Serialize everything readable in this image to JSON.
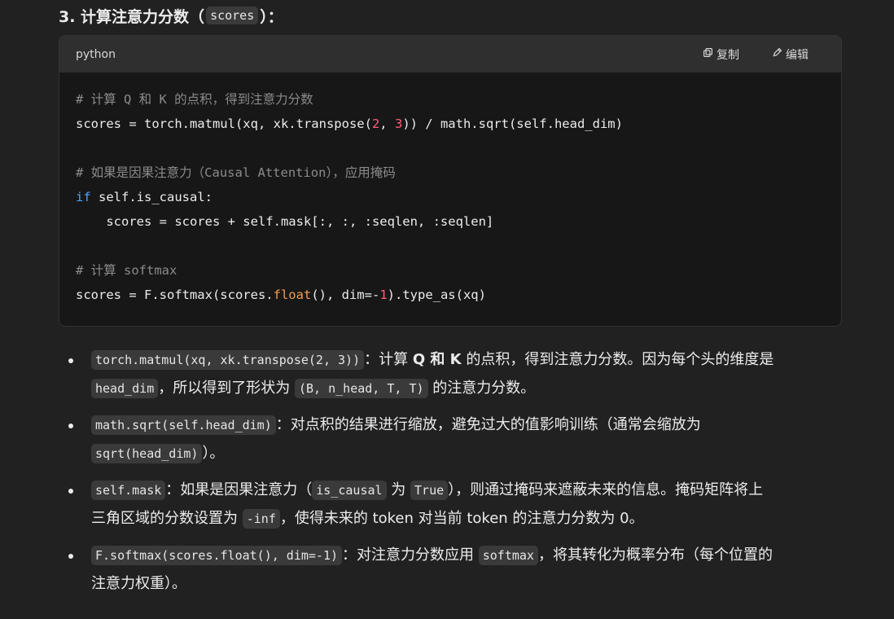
{
  "heading": {
    "prefix": "3. 计算注意力分数（",
    "code": "scores",
    "suffix": "）："
  },
  "code_block": {
    "language": "python",
    "copy_label": "复制",
    "edit_label": "编辑",
    "icons": {
      "copy": "copy-icon",
      "edit": "edit-icon"
    },
    "lines": [
      "# 计算 Q 和 K 的点积，得到注意力分数",
      "scores = torch.matmul(xq, xk.transpose(2, 3)) / math.sqrt(self.head_dim)",
      "",
      "# 如果是因果注意力（Causal Attention），应用掩码",
      "if self.is_causal:",
      "    scores = scores + self.mask[:, :, :seqlen, :seqlen]",
      "",
      "# 计算 softmax",
      "scores = F.softmax(scores.float(), dim=-1).type_as(xq)"
    ]
  },
  "bullets": [
    {
      "line1": {
        "code": "torch.matmul(xq, xk.transpose(2, 3))",
        "text_a": "：计算 ",
        "strong": "Q 和 K",
        "text_b": " 的点积，得到注意力分数。因为每个头的维度是"
      },
      "line2": {
        "code_a": "head_dim",
        "text_a": "，所以得到了形状为 ",
        "code_b": "(B, n_head, T, T)",
        "text_b": " 的注意力分数。"
      }
    },
    {
      "line1": {
        "code": "math.sqrt(self.head_dim)",
        "text_a": "：对点积的结果进行缩放，避免过大的值影响训练（通常会缩放为"
      },
      "line2": {
        "code_a": "sqrt(head_dim)",
        "text_a": "）。"
      }
    },
    {
      "line1": {
        "code": "self.mask",
        "text_a": "：如果是因果注意力（",
        "code_b": "is_causal",
        "text_b": " 为 ",
        "code_c": "True",
        "text_c": "），则通过掩码来遮蔽未来的信息。掩码矩阵将上"
      },
      "line2": {
        "text_a": "三角区域的分数设置为 ",
        "code_a": "-inf",
        "text_b": "，使得未来的 token 对当前 token 的注意力分数为 0。"
      }
    },
    {
      "line1": {
        "code": "F.softmax(scores.float(), dim=-1)",
        "text_a": "：对注意力分数应用 ",
        "code_b": "softmax",
        "text_b": "，将其转化为概率分布（每个位置的"
      },
      "line2": {
        "text_a": "注意力权重）。"
      }
    }
  ]
}
